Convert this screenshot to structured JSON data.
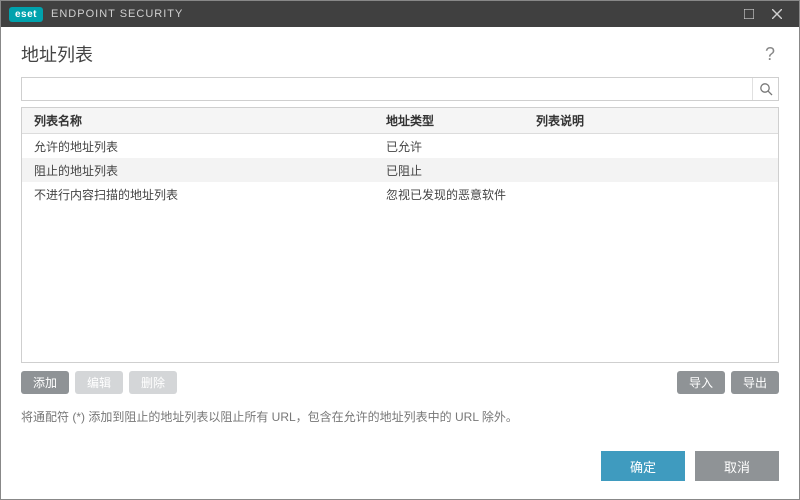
{
  "titlebar": {
    "badge": "eset",
    "product": "ENDPOINT SECURITY"
  },
  "header": {
    "title": "地址列表",
    "help": "?"
  },
  "search": {
    "value": ""
  },
  "table": {
    "headers": {
      "name": "列表名称",
      "type": "地址类型",
      "desc": "列表说明"
    },
    "rows": [
      {
        "name": "允许的地址列表",
        "type": "已允许",
        "desc": ""
      },
      {
        "name": "阻止的地址列表",
        "type": "已阻止",
        "desc": ""
      },
      {
        "name": "不进行内容扫描的地址列表",
        "type": "忽视已发现的恶意软件",
        "desc": ""
      }
    ]
  },
  "actions": {
    "add": "添加",
    "edit": "编辑",
    "delete": "删除",
    "import": "导入",
    "export": "导出"
  },
  "hint": "将通配符 (*) 添加到阻止的地址列表以阻止所有 URL，包含在允许的地址列表中的 URL 除外。",
  "footer": {
    "ok": "确定",
    "cancel": "取消"
  }
}
